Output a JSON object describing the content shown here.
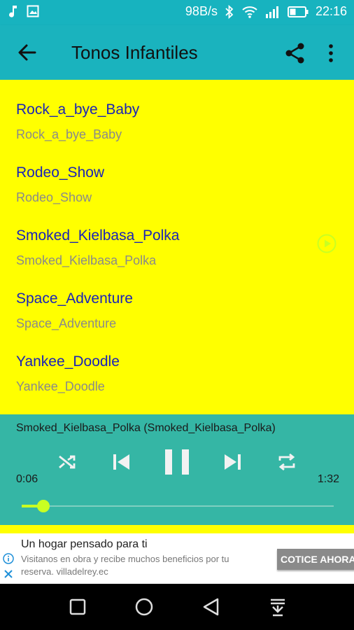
{
  "status_bar": {
    "speed": "98B/s",
    "time": "22:16",
    "icons": [
      "music-note-icon",
      "image-icon",
      "bluetooth-icon",
      "wifi-icon",
      "signal-icon",
      "battery-icon"
    ]
  },
  "toolbar": {
    "title": "Tonos Infantiles",
    "icons": [
      "back-arrow-icon",
      "share-icon",
      "more-vert-icon"
    ]
  },
  "ringtones": [
    {
      "name": "Rock_a_bye_Baby",
      "subtitle": "Rock_a_bye_Baby",
      "playing": false
    },
    {
      "name": "Rodeo_Show",
      "subtitle": "Rodeo_Show",
      "playing": false
    },
    {
      "name": "Smoked_Kielbasa_Polka",
      "subtitle": "Smoked_Kielbasa_Polka",
      "playing": true
    },
    {
      "name": "Space_Adventure",
      "subtitle": "Space_Adventure",
      "playing": false
    },
    {
      "name": "Yankee_Doodle",
      "subtitle": "Yankee_Doodle",
      "playing": false
    }
  ],
  "player": {
    "now_playing": "Smoked_Kielbasa_Polka (Smoked_Kielbasa_Polka)",
    "elapsed": "0:06",
    "duration": "1:32",
    "progress": 0.07,
    "controls": [
      "shuffle-icon",
      "previous-icon",
      "pause-icon",
      "next-icon",
      "repeat-icon"
    ]
  },
  "ad": {
    "headline": "Un hogar pensado para ti",
    "body": "Visitanos en obra y recibe muchos beneficios por tu reserva. villadelrey.ec",
    "cta": "COTICE AHORA"
  },
  "colors": {
    "toolbar": "#1ab3be",
    "list_background": "#ffff00",
    "player_background": "#35b6a5",
    "accent": "#c9ff22",
    "title_text": "#1a23b8"
  }
}
